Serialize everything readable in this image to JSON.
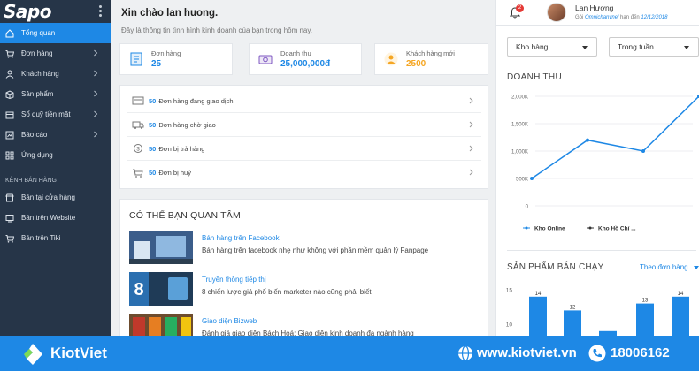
{
  "app": {
    "logo": "Sapo"
  },
  "sidebar": {
    "items": [
      {
        "label": "Tổng quan",
        "icon": "home-icon",
        "active": true,
        "chevron": false
      },
      {
        "label": "Đơn hàng",
        "icon": "cart-icon",
        "active": false,
        "chevron": true
      },
      {
        "label": "Khách hàng",
        "icon": "user-icon",
        "active": false,
        "chevron": true
      },
      {
        "label": "Sản phẩm",
        "icon": "box-icon",
        "active": false,
        "chevron": true
      },
      {
        "label": "Sổ quỹ tiền mặt",
        "icon": "wallet-icon",
        "active": false,
        "chevron": true
      },
      {
        "label": "Báo cáo",
        "icon": "chart-icon",
        "active": false,
        "chevron": true
      },
      {
        "label": "Ứng dụng",
        "icon": "apps-icon",
        "active": false,
        "chevron": false
      }
    ],
    "section_label": "KÊNH BÁN HÀNG",
    "channels": [
      {
        "label": "Bán tại cửa hàng",
        "icon": "store-icon"
      },
      {
        "label": "Bán trên Website",
        "icon": "web-icon"
      },
      {
        "label": "Bán trên Tiki",
        "icon": "cart-icon"
      }
    ]
  },
  "greeting": {
    "title": "Xin chào lan huong.",
    "subtitle": "Đây là thông tin tình hình kinh doanh của bạn trong hôm nay."
  },
  "stats": [
    {
      "label": "Đơn hàng",
      "value": "25",
      "icon": "invoice-icon"
    },
    {
      "label": "Doanh thu",
      "value": "25,000,000đ",
      "icon": "money-icon"
    },
    {
      "label": "Khách hàng mới",
      "value": "2500",
      "icon": "new-customer-icon"
    }
  ],
  "orders": [
    {
      "count": "50",
      "text": "Đơn hàng đang giao dịch",
      "icon": "transaction-icon"
    },
    {
      "count": "50",
      "text": "Đơn hàng chờ giao",
      "icon": "truck-icon"
    },
    {
      "count": "50",
      "text": "Đơn bị trả hàng",
      "icon": "return-icon"
    },
    {
      "count": "50",
      "text": "Đơn bị huỷ",
      "icon": "cart-cancel-icon"
    }
  ],
  "interest": {
    "title": "CÓ THỂ BẠN QUAN TÂM",
    "items": [
      {
        "title": "Bán hàng trên Facebook",
        "desc": "Bán hàng trên facebook nhẹ như không với phần mềm quản lý Fanpage",
        "thumb_text": ""
      },
      {
        "title": "Truyền thông tiếp thị",
        "desc": "8 chiến lược giá phổ biến marketer nào cũng phải biết",
        "thumb_text": "8 ĐỊNH GIÁ PHỔ BIẾN"
      },
      {
        "title": "Giao diện Bizweb",
        "desc": "Đánh giá giao diện Bách Hoá: Giao diện kinh doanh đa ngành hàng",
        "thumb_text": ""
      }
    ]
  },
  "user": {
    "name": "Lan Hương",
    "plan_prefix": "Gói",
    "plan_name": "Omnichanvnel",
    "plan_mid": "hạn đến",
    "plan_date": "12/12/2018",
    "notifications": "2"
  },
  "filters": {
    "store": "Kho hàng",
    "period": "Trong tuần"
  },
  "revenue_chart_title": "DOANH THU",
  "bestseller": {
    "title": "SẢN PHẨM BÁN CHẠY",
    "sort_label": "Theo đơn hàng"
  },
  "chart_data": [
    {
      "type": "line",
      "title": "DOANH THU",
      "y_ticks": [
        "2,000K",
        "1,500K",
        "1,000K",
        "500K",
        "0"
      ],
      "ylim": [
        0,
        2000
      ],
      "x": [
        1,
        2,
        3,
        4
      ],
      "series": [
        {
          "name": "Kho Online",
          "values": [
            500,
            1200,
            1000,
            2000
          ],
          "color": "#1e88e5"
        },
        {
          "name": "Kho Hồ Chí ...",
          "values": [],
          "color": "#333333"
        }
      ],
      "legend": "bottom",
      "grid": true
    },
    {
      "type": "bar",
      "title": "SẢN PHẨM BÁN CHẠY",
      "y_ticks": [
        "15",
        "10"
      ],
      "values": [
        14,
        12,
        9,
        13,
        14
      ],
      "data_labels": [
        "14",
        "12",
        "",
        "13",
        "14"
      ],
      "color": "#1e88e5"
    }
  ],
  "footer": {
    "brand": "KiotViet",
    "website": "www.kiotviet.vn",
    "phone": "18006162"
  },
  "colors": {
    "primary": "#1e88e5",
    "sidebar": "#263548",
    "accent": "#f5a623"
  }
}
